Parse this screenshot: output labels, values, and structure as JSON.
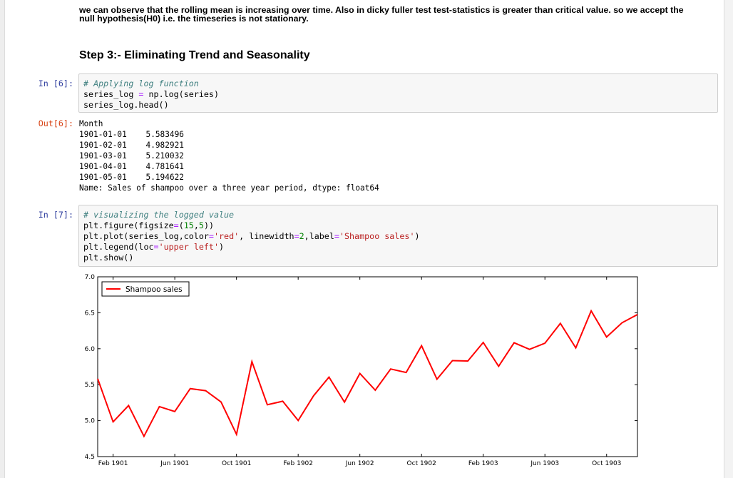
{
  "markdown": {
    "observation_line1": "we can observe that the rolling mean is increasing over time. Also in dicky fuller test test-statistics is greater than critical value. so we accept the",
    "observation_line2": "null hypothesis(H0) i.e. the timeseries is not stationary.",
    "heading": "Step 3:- Eliminating Trend and Seasonality"
  },
  "cells": {
    "cell6": {
      "in_prompt": "In [6]:",
      "code": {
        "l1_comment": "# Applying log function",
        "l2_a": "series_log ",
        "l2_op": "=",
        "l2_b": " np.log(series)",
        "l3": "series_log.head()"
      },
      "out_prompt": "Out[6]:",
      "output": {
        "header": "Month",
        "rows": [
          {
            "date": "1901-01-01",
            "value": "5.583496"
          },
          {
            "date": "1901-02-01",
            "value": "4.982921"
          },
          {
            "date": "1901-03-01",
            "value": "5.210032"
          },
          {
            "date": "1901-04-01",
            "value": "4.781641"
          },
          {
            "date": "1901-05-01",
            "value": "5.194622"
          }
        ],
        "footer": "Name: Sales of shampoo over a three year period, dtype: float64"
      }
    },
    "cell7": {
      "in_prompt": "In [7]:",
      "code": {
        "l1_comment": "# visualizing the logged value",
        "l2_a": "plt.figure(figsize",
        "l2_op": "=",
        "l2_b": "(",
        "l2_n1": "15",
        "l2_c": ",",
        "l2_n2": "5",
        "l2_d": "))",
        "l3_a": "plt.plot(series_log,color",
        "l3_op1": "=",
        "l3_s1": "'red'",
        "l3_b": ", linewidth",
        "l3_op2": "=",
        "l3_n": "2",
        "l3_c": ",label",
        "l3_op3": "=",
        "l3_s2": "'Shampoo sales'",
        "l3_d": ")",
        "l4_a": "plt.legend(loc",
        "l4_op": "=",
        "l4_s": "'upper left'",
        "l4_b": ")",
        "l5": "plt.show()"
      }
    }
  },
  "chart_data": {
    "type": "line",
    "title": "",
    "xlabel": "",
    "ylabel": "",
    "x": [
      "1901-01",
      "1901-02",
      "1901-03",
      "1901-04",
      "1901-05",
      "1901-06",
      "1901-07",
      "1901-08",
      "1901-09",
      "1901-10",
      "1901-11",
      "1901-12",
      "1902-01",
      "1902-02",
      "1902-03",
      "1902-04",
      "1902-05",
      "1902-06",
      "1902-07",
      "1902-08",
      "1902-09",
      "1902-10",
      "1902-11",
      "1902-12",
      "1903-01",
      "1903-02",
      "1903-03",
      "1903-04",
      "1903-05",
      "1903-06",
      "1903-07",
      "1903-08",
      "1903-09",
      "1903-10",
      "1903-11",
      "1903-12"
    ],
    "series": [
      {
        "name": "Shampoo sales",
        "color": "#ff0000",
        "values": [
          5.583,
          4.983,
          5.21,
          4.782,
          5.195,
          5.127,
          5.445,
          5.417,
          5.26,
          4.81,
          5.82,
          5.221,
          5.27,
          5.002,
          5.346,
          5.605,
          5.258,
          5.656,
          5.424,
          5.718,
          5.67,
          6.042,
          5.576,
          5.834,
          5.829,
          6.087,
          5.756,
          6.083,
          5.991,
          6.076,
          6.353,
          6.012,
          6.527,
          6.163,
          6.361,
          6.475
        ]
      }
    ],
    "yticks": [
      "7.0",
      "6.5",
      "6.0",
      "5.5",
      "5.0",
      "4.5"
    ],
    "ylim": [
      4.5,
      7.0
    ],
    "xtick_labels": [
      {
        "label": "Feb 1901",
        "index": 1
      },
      {
        "label": "Jun 1901",
        "index": 5
      },
      {
        "label": "Oct 1901",
        "index": 9
      },
      {
        "label": "Feb 1902",
        "index": 13
      },
      {
        "label": "Jun 1902",
        "index": 17
      },
      {
        "label": "Oct 1902",
        "index": 21
      },
      {
        "label": "Feb 1903",
        "index": 25
      },
      {
        "label": "Jun 1903",
        "index": 29
      },
      {
        "label": "Oct 1903",
        "index": 33
      }
    ],
    "legend": {
      "position": "upper left",
      "label": "Shampoo sales"
    },
    "grid": false
  }
}
